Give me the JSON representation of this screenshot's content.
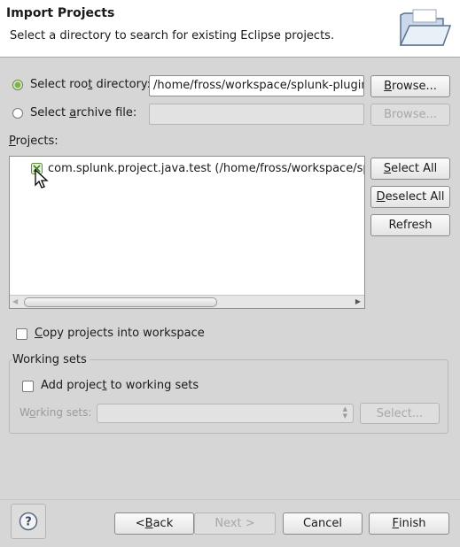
{
  "header": {
    "title": "Import Projects",
    "description": "Select a directory to search for existing Eclipse projects."
  },
  "source": {
    "root_dir_label_pre": "Select roo",
    "root_dir_label_mnemonic": "t",
    "root_dir_label_post": " directory:",
    "root_dir_value": "/home/fross/workspace/splunk-plugin-eclipse",
    "archive_label_pre": "Select ",
    "archive_label_mnemonic": "a",
    "archive_label_post": "rchive file:",
    "archive_value": "",
    "browse_label_mnemonic": "B",
    "browse_label_rest": "rowse..."
  },
  "projects": {
    "label_mnemonic": "P",
    "label_rest": "rojects:",
    "items": [
      {
        "label": "com.splunk.project.java.test (/home/fross/workspace/splunk-plugin-eclipse/com.splunk.project.java.test)"
      }
    ],
    "select_all_mnemonic": "S",
    "select_all_rest": "elect All",
    "deselect_all_mnemonic": "D",
    "deselect_all_rest": "eselect All",
    "refresh_label": "Refresh"
  },
  "copy_projects": {
    "mnemonic": "C",
    "rest": "opy projects into workspace"
  },
  "working_sets": {
    "group_title": "Working sets",
    "add_pre": "Add projec",
    "add_mnemonic": "t",
    "add_post": " to working sets",
    "ws_label_pre": "W",
    "ws_label_mnemonic": "o",
    "ws_label_post": "rking sets:",
    "select_label": "Select..."
  },
  "footer": {
    "back_pre": "< ",
    "back_mnemonic": "B",
    "back_post": "ack",
    "next_mnemonic": "N",
    "next_post": "ext >",
    "cancel_label": "Cancel",
    "finish_mnemonic": "F",
    "finish_post": "inish"
  }
}
